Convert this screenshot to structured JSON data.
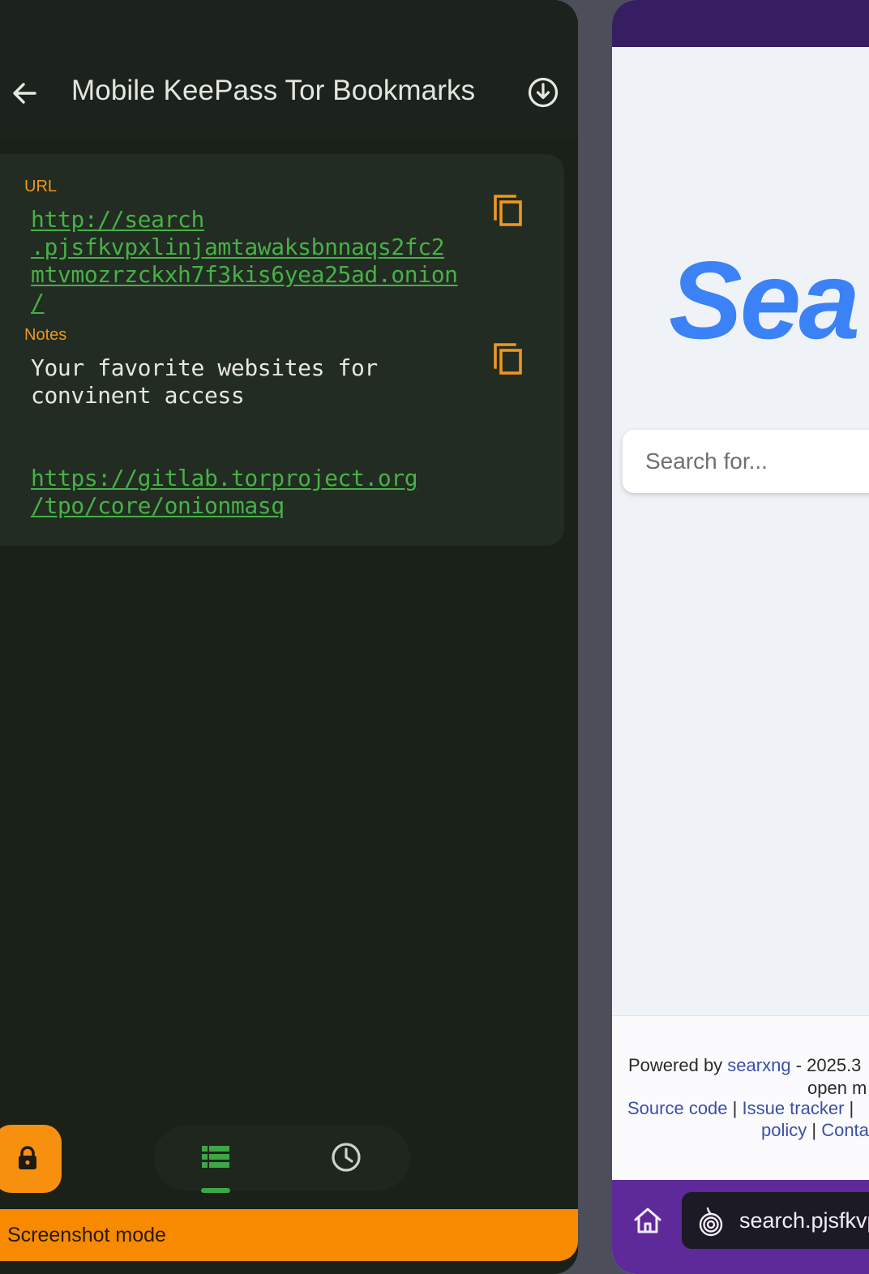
{
  "left_app": {
    "title": "Mobile KeePass Tor Bookmarks",
    "entry": {
      "url_label": "URL",
      "url_lines": [
        "http://search",
        ".pjsfkvpxlinjamtawaksbnnaqs2fc2",
        "mtvmozrzckxh7f3kis6yea25ad.onion",
        "/"
      ],
      "notes_label": "Notes",
      "notes_lines": [
        "Your favorite websites for",
        "convinent access"
      ],
      "notes_link_lines": [
        "https://gitlab.torproject.org",
        "/tpo/core/onionmasq"
      ]
    },
    "screenshot_mode_label": "Screenshot mode",
    "icons": {
      "back": "arrow-left-icon",
      "download": "download-circle-icon",
      "copy": "copy-icon",
      "lock": "lock-icon",
      "entries": "list-icon",
      "history": "clock-icon"
    },
    "colors": {
      "background": "#1a2119",
      "accent": "#f7900f",
      "link": "#47b047"
    }
  },
  "browser": {
    "logo_text": "Sea",
    "search_placeholder": "Search for...",
    "footer": {
      "powered_by": "Powered by ",
      "searxng": "searxng",
      "version_fragment": " - 2025.3",
      "line2": "open m",
      "source_code": "Source code",
      "sep1": " | ",
      "issue_tracker": "Issue tracker",
      "sep2": " | ",
      "policy": "policy",
      "sep3": " | ",
      "contact": "Conta"
    },
    "address_text": "search.pjsfkvp",
    "icons": {
      "home": "home-icon",
      "onion": "onion-icon"
    },
    "colors": {
      "toolbar": "#5e2a99",
      "logo": "#3b82f6"
    }
  }
}
